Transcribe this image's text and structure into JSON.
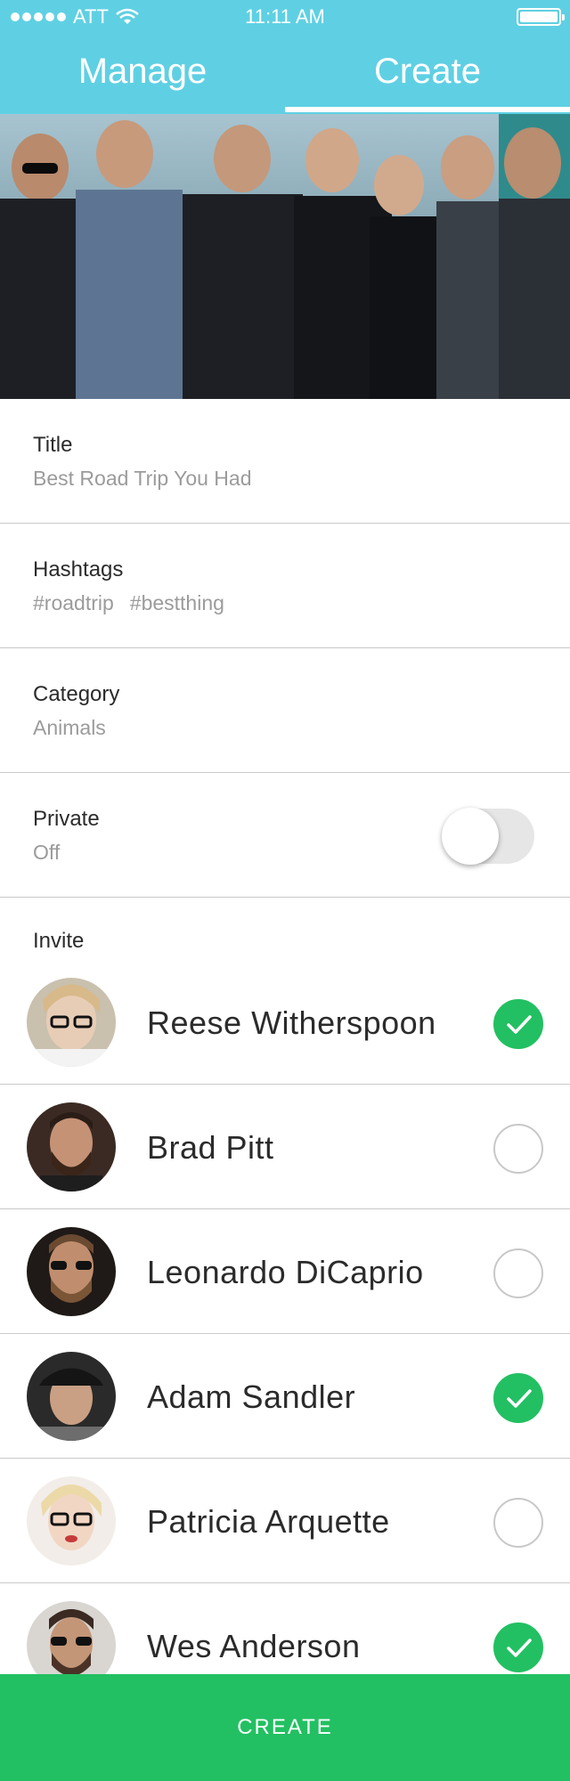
{
  "status_bar": {
    "carrier": "ATT",
    "time": "11:11 AM",
    "signal_icon": "signal-dots-icon",
    "wifi_icon": "wifi-icon",
    "battery_icon": "battery-icon"
  },
  "tabs": [
    {
      "label": "Manage",
      "active": false
    },
    {
      "label": "Create",
      "active": true
    }
  ],
  "colors": {
    "header": "#5fd0e3",
    "accent_green": "#22c062",
    "divider": "#c9c9c9",
    "value_text": "#9b9b9b"
  },
  "form": {
    "title": {
      "label": "Title",
      "value": "Best Road Trip You Had"
    },
    "hashtags": {
      "label": "Hashtags",
      "values": [
        "#roadtrip",
        "#bestthing"
      ]
    },
    "category": {
      "label": "Category",
      "value": "Animals"
    },
    "private": {
      "label": "Private",
      "value": "Off",
      "toggle_on": false
    }
  },
  "invite": {
    "label": "Invite",
    "people": [
      {
        "name": "Reese Witherspoon",
        "selected": true
      },
      {
        "name": "Brad Pitt",
        "selected": false
      },
      {
        "name": "Leonardo DiCaprio",
        "selected": false
      },
      {
        "name": "Adam Sandler",
        "selected": true
      },
      {
        "name": "Patricia Arquette",
        "selected": false
      },
      {
        "name": "Wes Anderson",
        "selected": true
      }
    ]
  },
  "create_button": {
    "label": "CREATE"
  }
}
